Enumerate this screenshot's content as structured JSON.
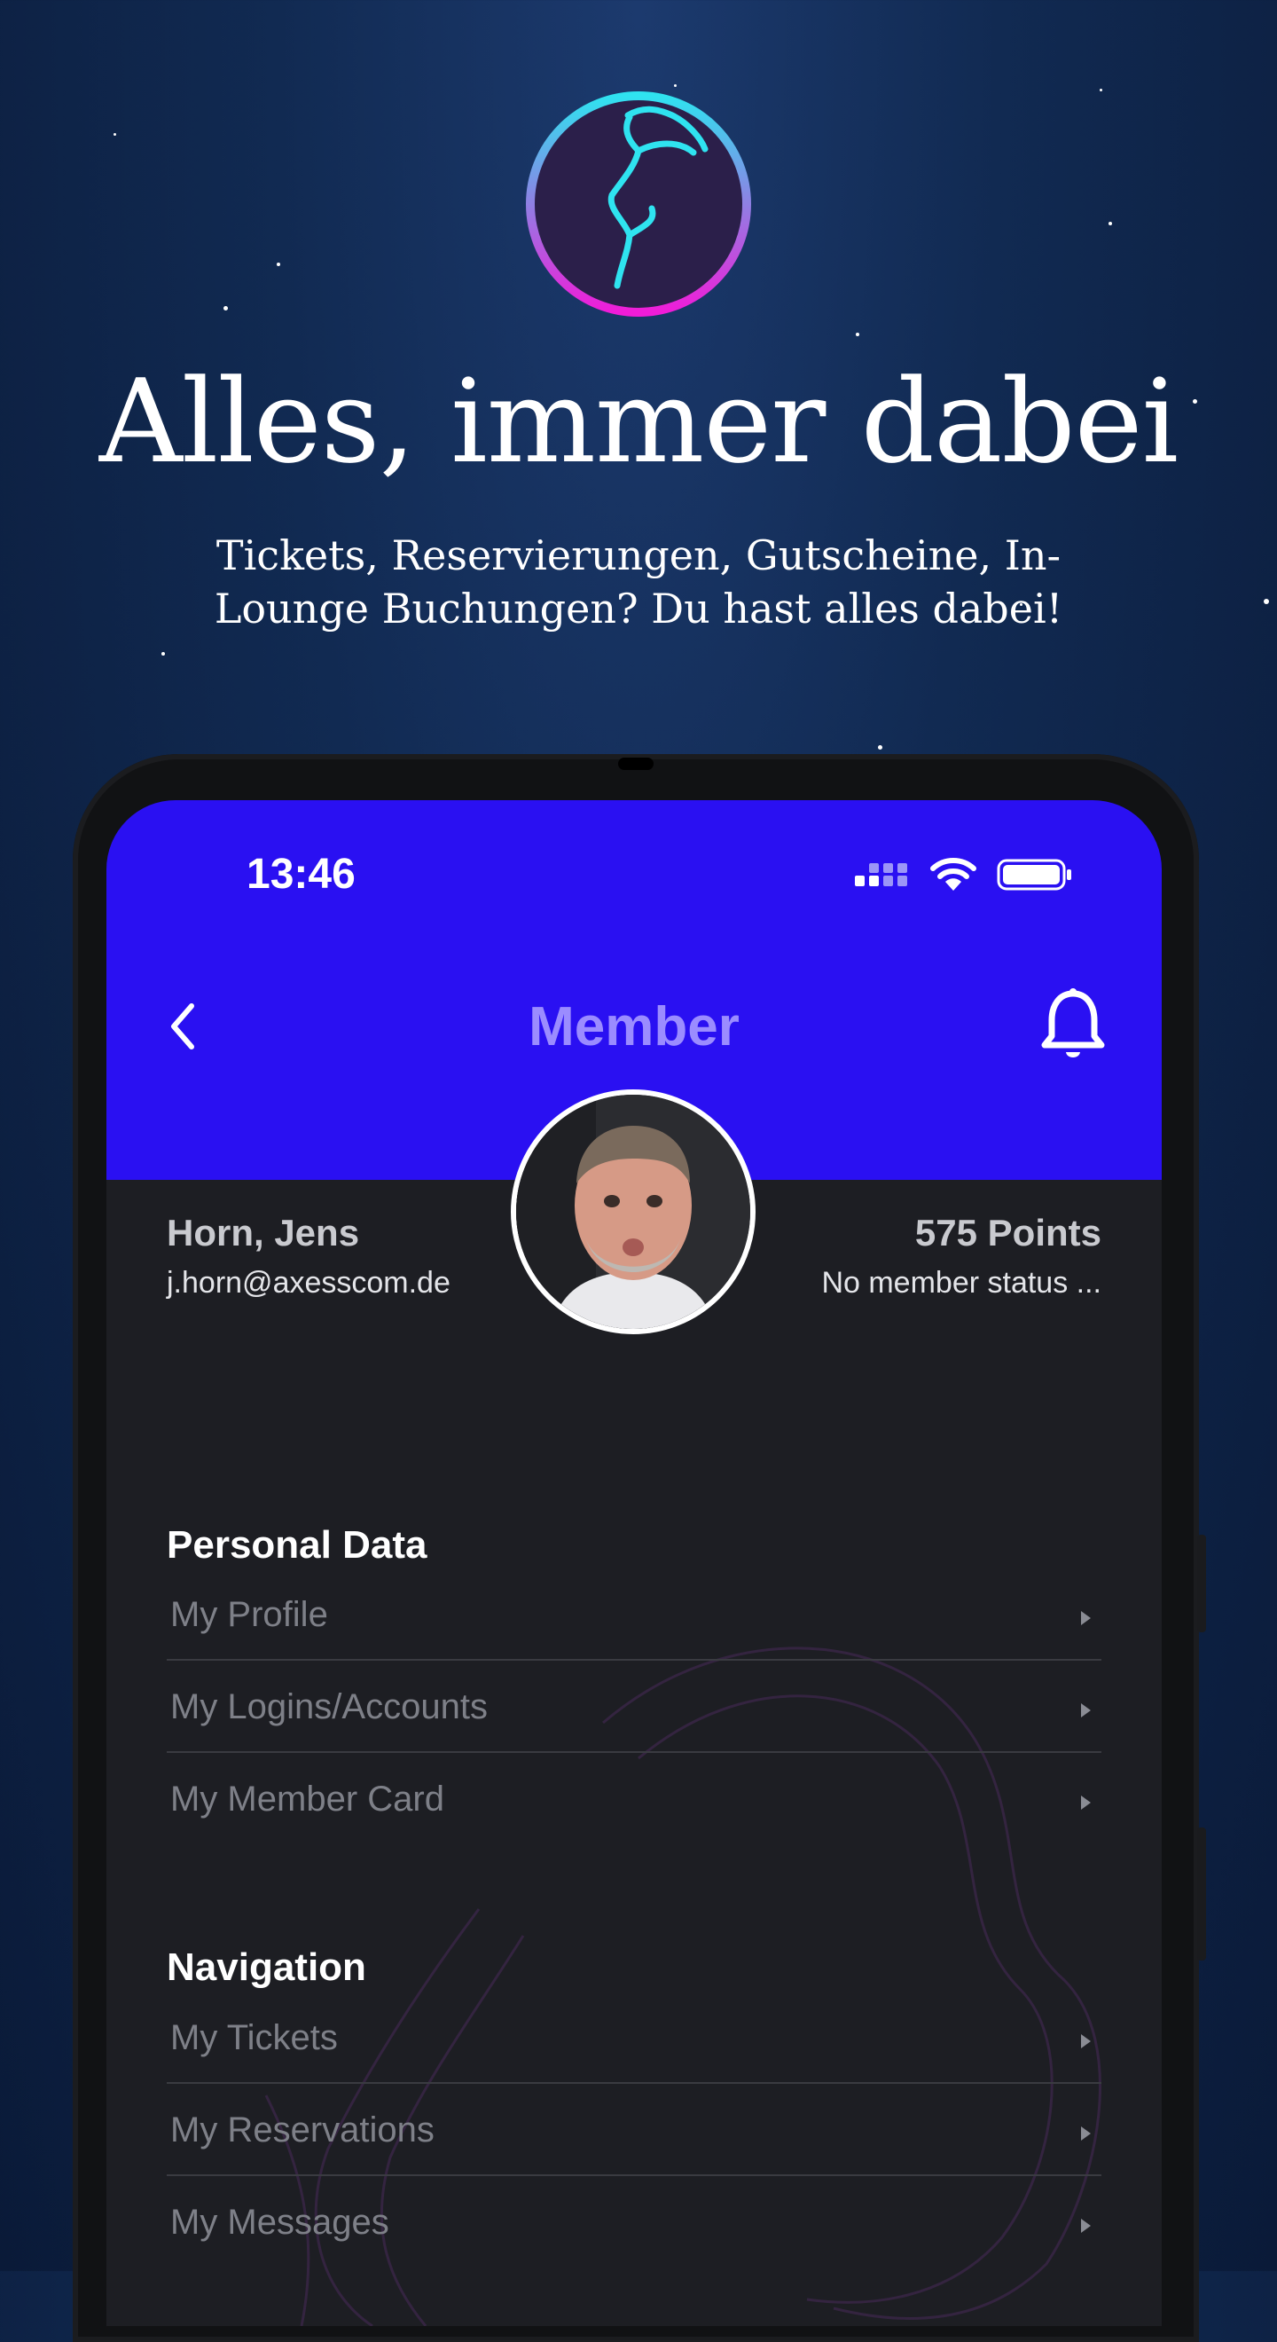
{
  "hero": {
    "headline": "Alles, immer dabei",
    "subline": "Tickets, Reservierungen, Gutscheine, In-Lounge Buchungen? Du hast alles dabei!",
    "logo_icon": "dancer-logo-icon"
  },
  "status_bar": {
    "time": "13:46",
    "icons": [
      "signal-icon",
      "wifi-icon",
      "battery-icon"
    ]
  },
  "nav": {
    "title": "Member",
    "back_icon": "chevron-left-icon",
    "bell_icon": "bell-icon"
  },
  "member": {
    "name": "Horn, Jens",
    "email": "j.horn@axesscom.de",
    "points": "575 Points",
    "status": "No member status ..."
  },
  "sections": [
    {
      "title": "Personal Data",
      "items": [
        {
          "label": "My Profile"
        },
        {
          "label": "My Logins/Accounts"
        },
        {
          "label": "My Member Card"
        }
      ]
    },
    {
      "title": "Navigation",
      "items": [
        {
          "label": "My Tickets"
        },
        {
          "label": "My Reservations"
        },
        {
          "label": "My Messages"
        }
      ]
    }
  ],
  "colors": {
    "header_blue": "#2a10f2",
    "screen_bg": "#1d1e23",
    "title_accent": "#9b8cff",
    "logo_cyan": "#2fe3f0",
    "logo_magenta": "#f01cd8"
  }
}
